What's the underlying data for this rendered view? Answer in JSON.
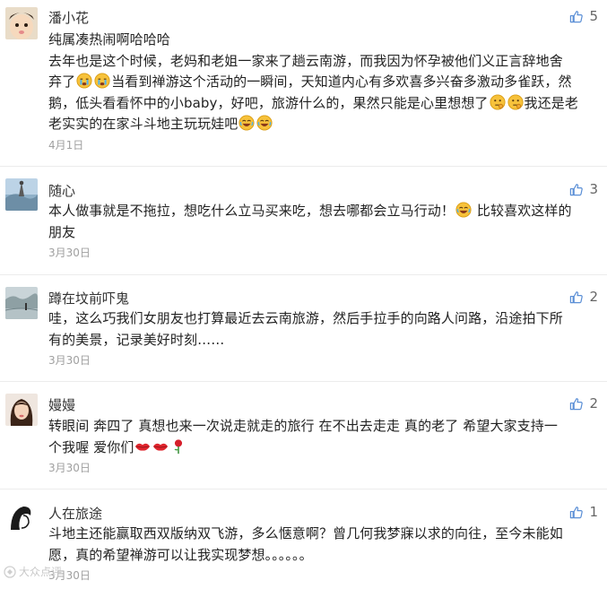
{
  "comments": [
    {
      "name": "潘小花",
      "likes": "5",
      "lines": [
        "纯属凑热闹啊哈哈哈",
        "去年也是这个时候，老妈和老姐一家来了趟云南游，而我因为怀孕被他们义正言辞地舍",
        "弃了",
        "当看到禅游这个活动的一瞬间，天知道内心有多欢喜多兴奋多激动多雀跃，然",
        "鹅，低头看看怀中的小baby，好吧，旅游什么的，果然只能是心里想想了",
        "我还是老",
        "老实实的在家斗斗地主玩玩娃吧"
      ],
      "date": "4月1日"
    },
    {
      "name": "随心",
      "likes": "3",
      "lines": [
        "本人做事就是不拖拉，想吃什么立马买来吃，想去哪都会立马行动！",
        "比较喜欢这样的",
        "朋友"
      ],
      "date": "3月30日"
    },
    {
      "name": "蹲在坟前吓鬼",
      "likes": "2",
      "lines": [
        "哇，这么巧我们女朋友也打算最近去云南旅游，然后手拉手的向路人问路，沿途拍下所",
        "有的美景，记录美好时刻……"
      ],
      "date": "3月30日"
    },
    {
      "name": "嫚嫚",
      "likes": "2",
      "lines": [
        "转眼间 奔四了  真想也来一次说走就走的旅行  在不出去走走  真的老了  希望大家支持一",
        "个我喔  爱你们"
      ],
      "date": "3月30日"
    },
    {
      "name": "人在旅途",
      "likes": "1",
      "lines": [
        "斗地主还能赢取西双版纳双飞游，多么惬意啊？曾几何我梦寐以求的向往，至今未能如",
        "愿，真的希望禅游可以让我实现梦想。。。。。。"
      ],
      "date": "3月30日"
    }
  ],
  "watermark": "大众点评",
  "colors": {
    "text": "#222222",
    "name": "#333333",
    "date": "#a0a0a0",
    "like_icon": "#5b8fd6",
    "divider": "#ececec"
  }
}
